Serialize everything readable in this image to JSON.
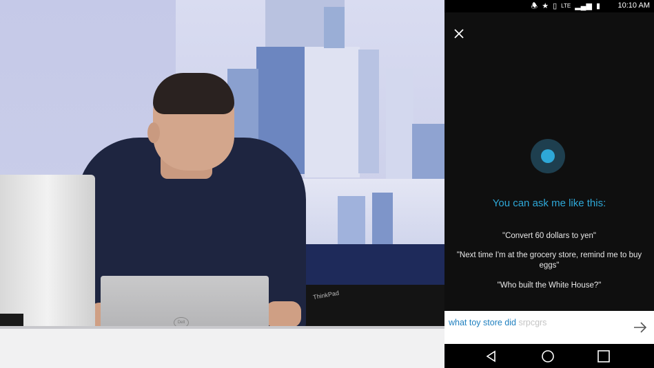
{
  "status_bar": {
    "time": "10:10 AM",
    "icons": [
      "bluetooth-icon",
      "star-icon",
      "vibrate-icon",
      "lte-icon",
      "signal-icon",
      "battery-icon"
    ]
  },
  "cortana": {
    "close_icon": "close-icon",
    "title": "You can ask me like this:",
    "examples": [
      "\"Convert 60 dollars to yen\"",
      "\"Next time I'm at the grocery store, remind me to buy eggs\"",
      "\"Who built the White House?\""
    ],
    "accent_color": "#2ea8d8"
  },
  "input": {
    "typed_text": "what toy store did",
    "suggestion_text": "srpcgrs",
    "send_icon": "arrow-right-icon"
  },
  "navbar": {
    "icons": [
      "back-icon",
      "home-icon",
      "recents-icon"
    ]
  },
  "stage": {
    "laptop_brand": "Dell",
    "second_laptop_brand": "ThinkPad"
  }
}
